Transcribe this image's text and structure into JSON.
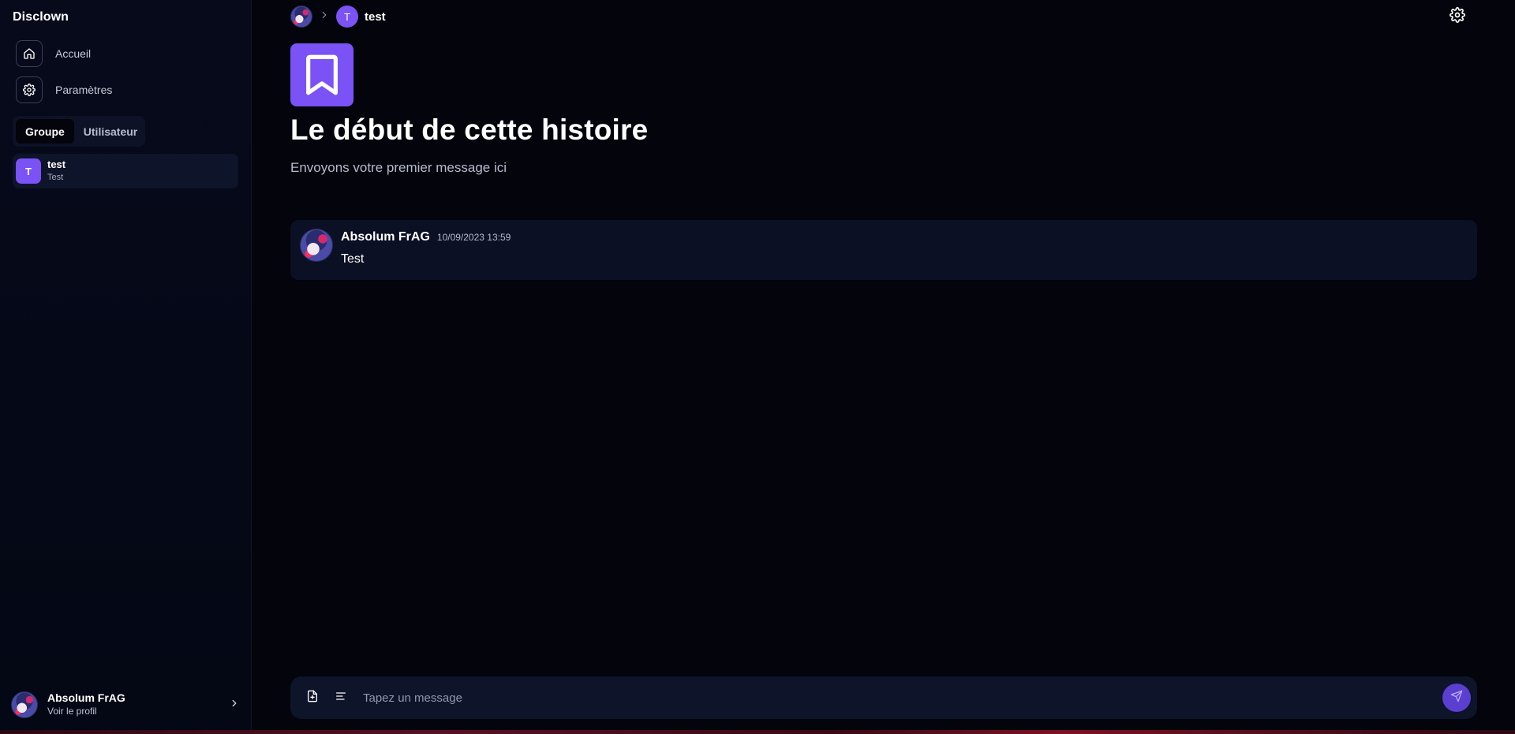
{
  "sidebar": {
    "brand": "Disclown",
    "nav": [
      {
        "label": "Accueil",
        "icon": "home-icon"
      },
      {
        "label": "Paramètres",
        "icon": "gear-icon"
      }
    ],
    "tabs": [
      {
        "label": "Groupe",
        "active": true
      },
      {
        "label": "Utilisateur",
        "active": false
      }
    ],
    "conversations": [
      {
        "initial": "T",
        "name": "test",
        "subtitle": "Test"
      }
    ],
    "profile": {
      "name": "Absolum FrAG",
      "link": "Voir le profil"
    }
  },
  "header": {
    "crumb_initial": "T",
    "crumb_name": "test"
  },
  "hero": {
    "title": "Le début de cette histoire",
    "subtitle": "Envoyons votre premier message ici"
  },
  "messages": [
    {
      "author": "Absolum FrAG",
      "timestamp": "10/09/2023 13:59",
      "text": "Test"
    }
  ],
  "composer": {
    "placeholder": "Tapez un message"
  },
  "colors": {
    "accent": "#7a52f5",
    "background": "#03040c",
    "panel": "#0e1429"
  }
}
